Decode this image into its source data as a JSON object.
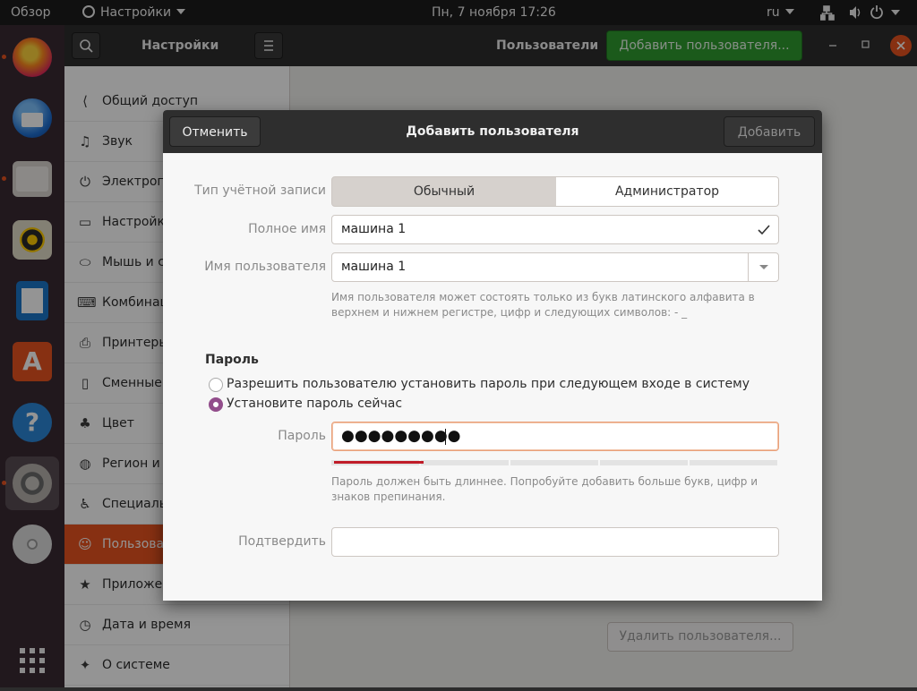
{
  "topbar": {
    "overview": "Обзор",
    "app_menu": "Настройки",
    "datetime": "Пн, 7 ноября  17:26",
    "lang": "ru"
  },
  "window": {
    "sidebar_title": "Настройки",
    "page_title": "Пользователи",
    "add_user_button": "Добавить пользователя...",
    "delete_user_button": "Удалить пользователя..."
  },
  "sidebar": {
    "items": [
      {
        "icon": "share-icon",
        "glyph": "⟨",
        "label": "Общий доступ"
      },
      {
        "icon": "music-note-icon",
        "glyph": "♫",
        "label": "Звук"
      },
      {
        "icon": "power-icon",
        "glyph": "⏻",
        "label": "Электропитание"
      },
      {
        "icon": "display-icon",
        "glyph": "▭",
        "label": "Настройки экрана"
      },
      {
        "icon": "mouse-icon",
        "glyph": "⬭",
        "label": "Мышь и сенсорная панель"
      },
      {
        "icon": "keyboard-icon",
        "glyph": "⌨",
        "label": "Комбинации клавиш"
      },
      {
        "icon": "printer-icon",
        "glyph": "⎙",
        "label": "Принтеры"
      },
      {
        "icon": "removable-media-icon",
        "glyph": "▯",
        "label": "Сменные носители"
      },
      {
        "icon": "color-icon",
        "glyph": "♣",
        "label": "Цвет"
      },
      {
        "icon": "globe-icon",
        "glyph": "◍",
        "label": "Регион и язык"
      },
      {
        "icon": "accessibility-icon",
        "glyph": "♿",
        "label": "Специальные возможности"
      },
      {
        "icon": "users-icon",
        "glyph": "☺",
        "label": "Пользователи"
      },
      {
        "icon": "star-icon",
        "glyph": "★",
        "label": "Приложения по умолчанию"
      },
      {
        "icon": "clock-icon",
        "glyph": "◷",
        "label": "Дата и время"
      },
      {
        "icon": "sparkle-icon",
        "glyph": "✦",
        "label": "О системе"
      }
    ]
  },
  "dialog": {
    "title": "Добавить пользователя",
    "cancel": "Отменить",
    "add": "Добавить",
    "account_type_label": "Тип учётной записи",
    "account_type_options": [
      "Обычный",
      "Администратор"
    ],
    "account_type_selected": "Обычный",
    "fullname_label": "Полное имя",
    "fullname_value": "машина 1",
    "username_label": "Имя пользователя",
    "username_value": "машина 1",
    "username_hint": "Имя пользователя может состоять только из букв латинского алфавита в верхнем и нижнем регистре, цифр и следующих символов: - _",
    "password_section": "Пароль",
    "radio_later": "Разрешить пользователю установить пароль при следующем входе в систему",
    "radio_now": "Установите пароль сейчас",
    "password_label": "Пароль",
    "password_value": "●●●●●●●●●",
    "password_strength": 0.2,
    "password_hint": "Пароль должен быть длиннее. Попробуйте добавить больше букв, цифр и знаков препинания.",
    "confirm_label": "Подтвердить",
    "confirm_value": ""
  },
  "colors": {
    "accent": "#e95420",
    "add_button_green": "#2f9c2f",
    "radio_purple": "#924d8b",
    "strength_red": "#c01c28"
  }
}
